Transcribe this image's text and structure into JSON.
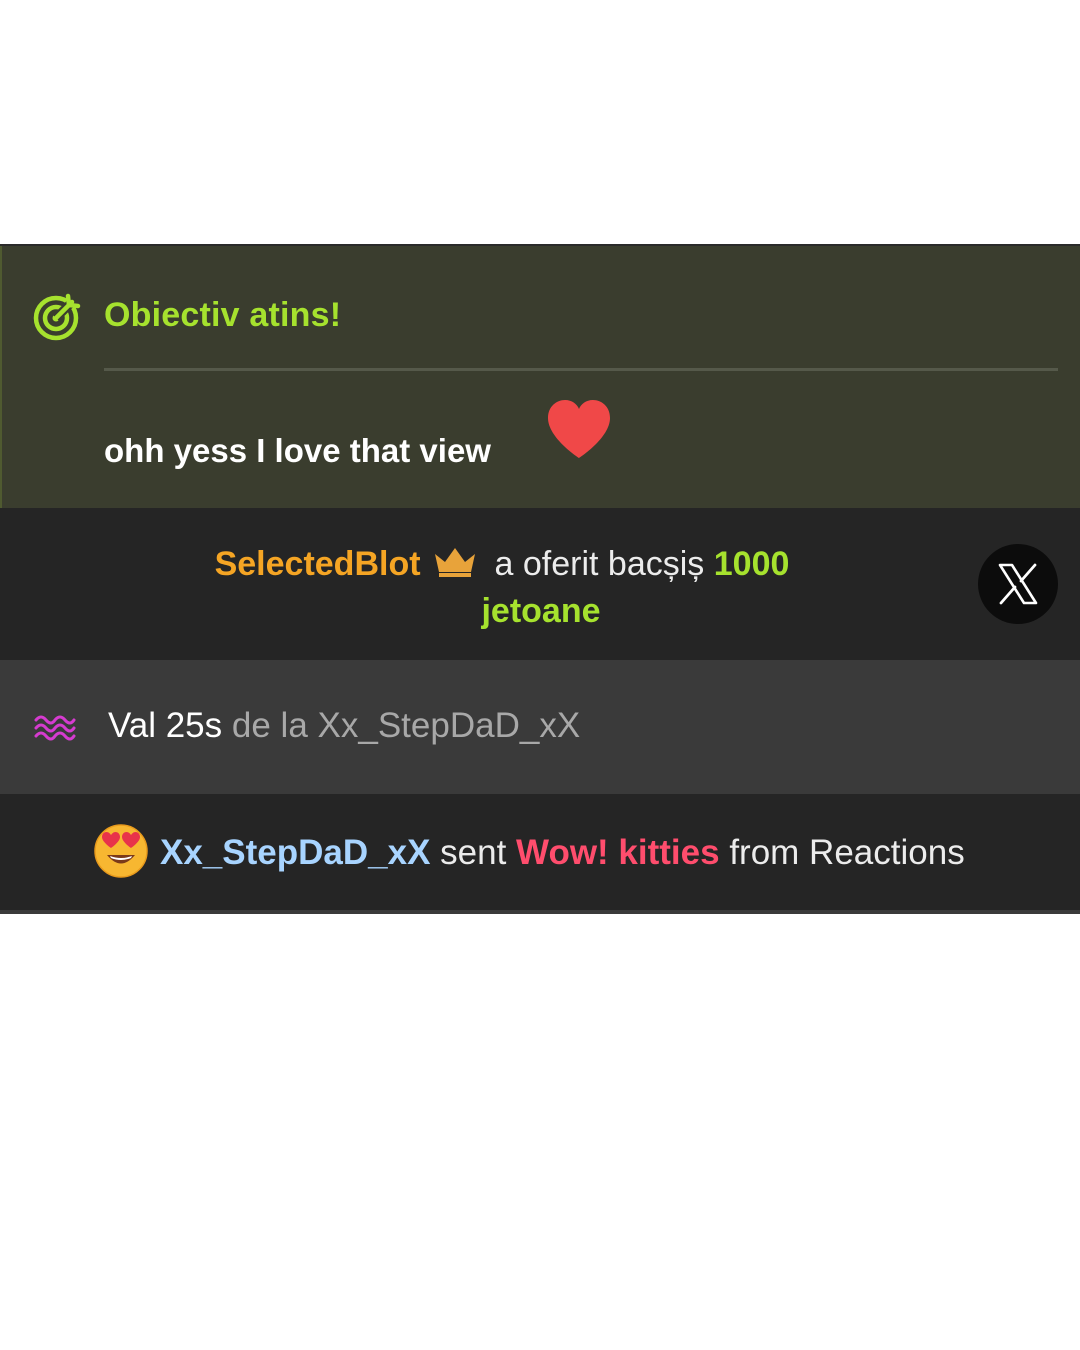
{
  "goal": {
    "title": "Obiectiv atins!",
    "message": "ohh yess I love that view",
    "accent": "#a6e22e",
    "icon": "target-icon",
    "emoji": "heart-icon"
  },
  "tip": {
    "username": "SelectedBlot",
    "badge_icon": "crown-icon",
    "text": "a oferit bacșiș",
    "amount": "1000",
    "unit": "jetoane",
    "close_icon": "x-icon",
    "user_color": "#f5a524"
  },
  "wave": {
    "icon": "wave-icon",
    "label": "Val 25s",
    "from": "de la",
    "username": "Xx_StepDaD_xX",
    "icon_color": "#d63bd0"
  },
  "reaction": {
    "emoji": "heart-eyes-emoji-icon",
    "username": "Xx_StepDaD_xX",
    "sent": "sent",
    "gift": "Wow! kitties",
    "source": "from Reactions",
    "user_color": "#a8d4ff",
    "gift_color": "#ff4d6d"
  }
}
